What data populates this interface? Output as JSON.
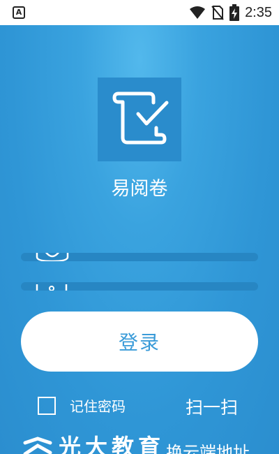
{
  "status_bar": {
    "time": "2:35",
    "notification_letter": "A",
    "icons": [
      "wifi-icon",
      "no-sim-icon",
      "battery-charging-icon"
    ]
  },
  "app": {
    "name": "易阅卷",
    "logo_icon": "scroll-checkmark-icon"
  },
  "login": {
    "username_icon": "user-icon",
    "password_icon": "lock-icon",
    "username_value": "",
    "password_value": "",
    "button_label": "登录"
  },
  "options": {
    "remember_label": "记住密码",
    "remember_checked": false,
    "scan_label": "扫一扫"
  },
  "footer": {
    "brand_name": "光大教育",
    "switch_server_label": "换云端地址"
  },
  "colors": {
    "background": "#2f96d6",
    "logo_box": "#2a8ccc",
    "field": "#2786c3",
    "button_text": "#3a9bd8"
  }
}
